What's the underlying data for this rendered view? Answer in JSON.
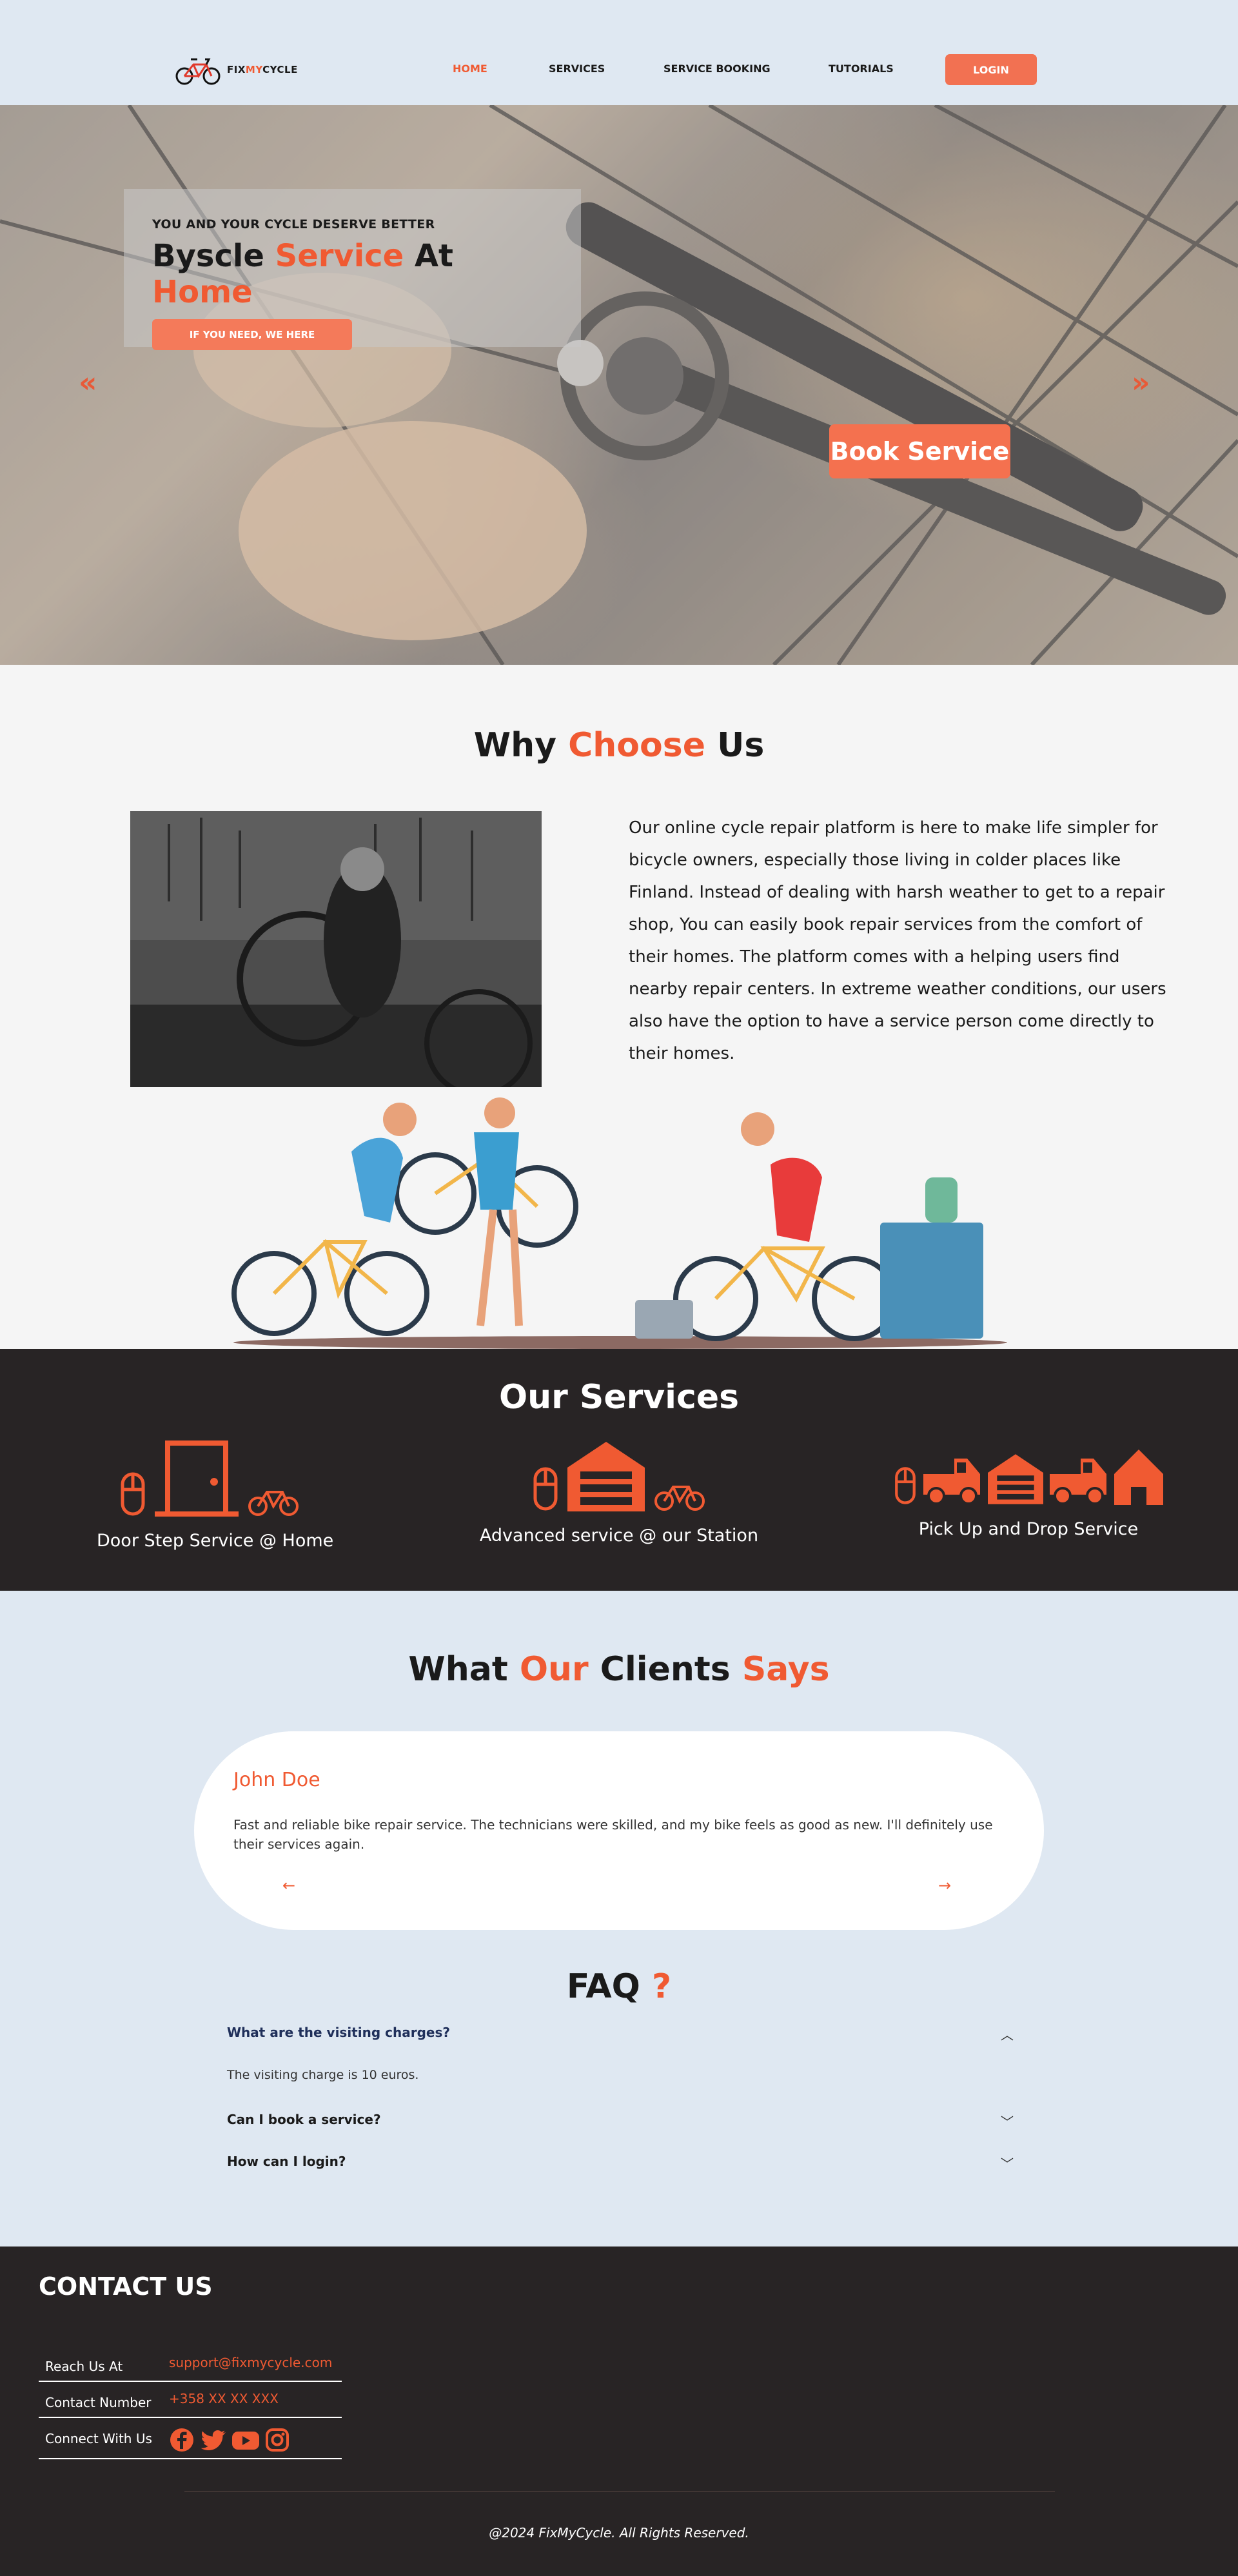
{
  "brand": {
    "logo_text_pre": "FIX",
    "logo_text_my": "MY",
    "logo_text_post": "CYCLE"
  },
  "nav": {
    "items": [
      {
        "label": "HOME",
        "active": true
      },
      {
        "label": "SERVICES",
        "active": false
      },
      {
        "label": "SERVICE BOOKING",
        "active": false
      },
      {
        "label": "TUTORIALS",
        "active": false
      }
    ],
    "login_label": "LOGIN"
  },
  "hero": {
    "kicker": "YOU AND YOUR CYCLE DESERVE BETTER",
    "title_part1": "Byscle ",
    "title_part2": "Service",
    "title_part3": " At ",
    "title_part4": "Home",
    "cta_label": "IF YOU NEED, WE HERE",
    "prev_icon": "«",
    "next_icon": "»",
    "book_label": "Book Service"
  },
  "why": {
    "title_part1": "Why ",
    "title_part2": "Choose",
    "title_part3": " Us",
    "body": "Our online cycle repair platform is here to make life simpler for bicycle owners, especially those living in colder places like Finland. Instead of dealing with harsh weather to get to a repair shop, You can easily book repair services from the comfort of their homes. The platform comes with a helping users find nearby repair centers. In extreme weather conditions, our users also have the option to have a service person come directly to their homes."
  },
  "services": {
    "title": "Our Services",
    "items": [
      {
        "label": "Door Step Service @ Home",
        "icons": [
          "mouse-icon",
          "door-icon",
          "bicycle-icon"
        ]
      },
      {
        "label": "Advanced service @ our Station",
        "icons": [
          "mouse-icon",
          "garage-icon",
          "bicycle-icon"
        ]
      },
      {
        "label": "Pick Up and Drop Service",
        "icons": [
          "mouse-icon",
          "truck-icon",
          "garage-icon",
          "truck-icon",
          "house-icon"
        ]
      }
    ]
  },
  "clients": {
    "title_part1": "What ",
    "title_part2": "Our",
    "title_part3": " Clients ",
    "title_part4": "Says",
    "testimonial": {
      "name": "John Doe",
      "text": "Fast and reliable bike repair service. The technicians were skilled, and my bike feels as good as new. I'll definitely use their services again.",
      "prev": "←",
      "next": "→"
    }
  },
  "faq": {
    "title_part1": "FAQ ",
    "title_part2": "?",
    "items": [
      {
        "question": "What are the visiting charges?",
        "answer": "The visiting charge is 10 euros.",
        "open": true
      },
      {
        "question": "Can I book a service?",
        "open": false
      },
      {
        "question": "How can I login?",
        "open": false
      }
    ]
  },
  "footer": {
    "contact_title": "CONTACT US",
    "rows": [
      {
        "label": "Reach Us At",
        "value": "support@fixmycycle.com"
      },
      {
        "label": "Contact Number",
        "value": "+358 XX XX XXX"
      },
      {
        "label": "Connect With Us",
        "value": ""
      }
    ],
    "social_icons": [
      "facebook-icon",
      "twitter-icon",
      "youtube-icon",
      "instagram-icon"
    ],
    "copyright": "@2024 FixMyCycle. All Rights Reserved."
  },
  "colors": {
    "accent": "#f05a32",
    "button": "#f27152",
    "dark": "#282425",
    "light_bg": "#dfe8f2"
  }
}
